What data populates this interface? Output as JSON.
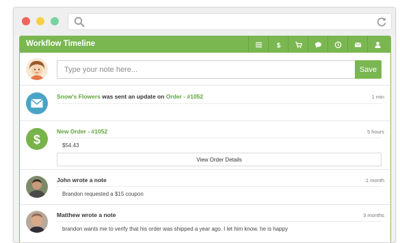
{
  "window": {
    "controls": [
      "close",
      "minimize",
      "maximize"
    ]
  },
  "toolbar": {
    "search_icon": "search-icon",
    "refresh_icon": "refresh-icon"
  },
  "panel": {
    "title": "Workflow Timeline",
    "header_icons": [
      "list-icon",
      "dollar-icon",
      "cart-icon",
      "chat-icon",
      "clock-icon",
      "envelope-icon",
      "user-icon"
    ],
    "accent_color": "#7ab750"
  },
  "composer": {
    "placeholder": "Type your note here...",
    "save_label": "Save"
  },
  "entries": [
    {
      "type": "email",
      "icon": "envelope-icon",
      "icon_color": "#4aa3c7",
      "actor": "Snow's Flowers",
      "action": " was sent an update on ",
      "target": "Order - #1052",
      "time": "1 min"
    },
    {
      "type": "order",
      "icon": "dollar-icon",
      "icon_color": "#78b34b",
      "title": "New Order - #1052",
      "time": "5 hours",
      "amount": "$54.43",
      "button_label": "View Order Details"
    },
    {
      "type": "note",
      "author_line": "John wrote a note",
      "time": "1 month",
      "body": "Brandon requested a $15 coupon"
    },
    {
      "type": "note",
      "author_line": "Matthew wrote a note",
      "time": "3 months",
      "body": "brandon wants me to verify that his order was shipped a year ago. I let him know. he is happy"
    }
  ]
}
